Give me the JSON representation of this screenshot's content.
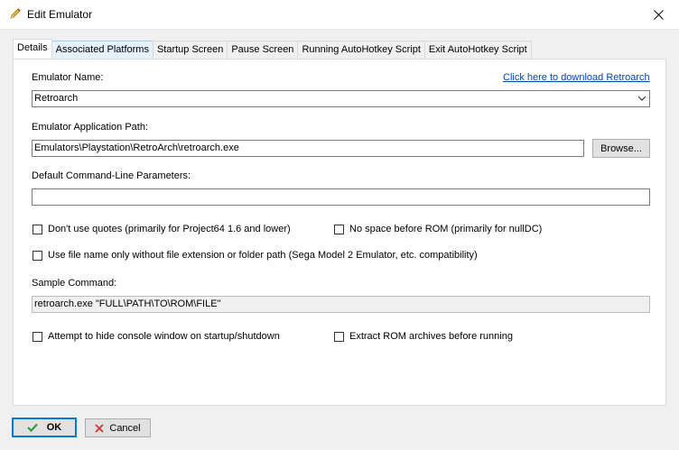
{
  "window": {
    "title": "Edit Emulator"
  },
  "tabs": [
    {
      "label": "Details"
    },
    {
      "label": "Associated Platforms"
    },
    {
      "label": "Startup Screen"
    },
    {
      "label": "Pause Screen"
    },
    {
      "label": "Running AutoHotkey Script"
    },
    {
      "label": "Exit AutoHotkey Script"
    }
  ],
  "details": {
    "emulator_name_label": "Emulator Name:",
    "download_link": "Click here to download Retroarch",
    "emulator_name_value": "Retroarch",
    "app_path_label": "Emulator Application Path:",
    "app_path_value": "Emulators\\Playstation\\RetroArch\\retroarch.exe",
    "browse_label": "Browse...",
    "cmdline_label": "Default Command-Line Parameters:",
    "cmdline_value": "",
    "chk_no_quotes": "Don't use quotes (primarily for Project64 1.6 and lower)",
    "chk_no_space": "No space before ROM (primarily for nullDC)",
    "chk_filename_only": "Use file name only without file extension or folder path (Sega Model 2 Emulator, etc. compatibility)",
    "sample_label": "Sample Command:",
    "sample_value": "retroarch.exe \"FULL\\PATH\\TO\\ROM\\FILE\"",
    "chk_hide_console": "Attempt to hide console window on startup/shutdown",
    "chk_extract_rom": "Extract ROM archives before running"
  },
  "footer": {
    "ok_label": "OK",
    "cancel_label": "Cancel"
  },
  "colors": {
    "link": "#0645ad",
    "ok_check": "#2e9e3c",
    "cancel_x": "#d13438",
    "focus": "#0078d7"
  },
  "icons": {
    "title": "pencil-icon",
    "close": "close-icon",
    "ok": "checkmark-icon",
    "cancel": "x-icon",
    "combo": "chevron-down-icon"
  }
}
